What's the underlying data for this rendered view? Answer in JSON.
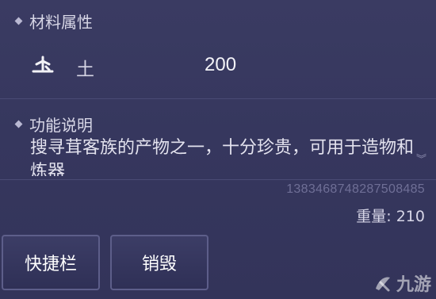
{
  "material_section": {
    "title": "材料属性",
    "attribute": {
      "icon": "earth-element-icon",
      "name": "土",
      "value": "200"
    }
  },
  "function_section": {
    "title": "功能说明",
    "description": "搜寻茸客族的产物之一，十分珍贵，可用于造物和炼器"
  },
  "item_serial": "1383468748287508485",
  "weight_label": "重量: 210",
  "buttons": {
    "quick_bar": "快捷栏",
    "destroy": "销毁"
  },
  "watermark": {
    "text": "九游",
    "logo": "jiuyou-logo"
  },
  "colors": {
    "panel_bg": "#36375e",
    "text_primary": "#e3e2ee",
    "serial_text": "#6f6f96",
    "button_border": "#5d5e8a"
  }
}
